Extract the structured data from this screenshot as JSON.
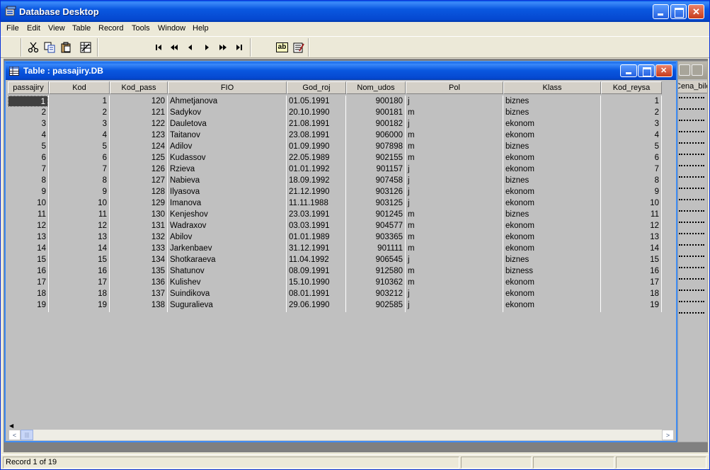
{
  "app": {
    "title": "Database Desktop"
  },
  "menu": [
    "File",
    "Edit",
    "View",
    "Table",
    "Record",
    "Tools",
    "Window",
    "Help"
  ],
  "toolbar": {
    "buttons": [
      "cut-icon",
      "copy-icon",
      "paste-icon",
      "restructure-icon",
      "first-record-icon",
      "prev-set-icon",
      "prev-record-icon",
      "next-record-icon",
      "next-set-icon",
      "last-record-icon",
      "field-view-icon",
      "edit-data-icon"
    ],
    "field_view_label": "ab"
  },
  "table_window": {
    "title": "Table : passajiry.DB",
    "columns": [
      "passajiry",
      "Kod",
      "Kod_pass",
      "FIO",
      "God_roj",
      "Nom_udos",
      "Pol",
      "Klass",
      "Kod_reysa"
    ],
    "rows": [
      [
        "1",
        "1",
        "120",
        "Ahmetjanova",
        "01.05.1991",
        "900180",
        "j",
        "biznes",
        "1"
      ],
      [
        "2",
        "2",
        "121",
        "Sadykov",
        "20.10.1990",
        "900181",
        "m",
        "biznes",
        "2"
      ],
      [
        "3",
        "3",
        "122",
        "Dauletova",
        "21.08.1991",
        "900182",
        "j",
        "ekonom",
        "3"
      ],
      [
        "4",
        "4",
        "123",
        "Taitanov",
        "23.08.1991",
        "906000",
        "m",
        "ekonom",
        "4"
      ],
      [
        "5",
        "5",
        "124",
        "Adilov",
        "01.09.1990",
        "907898",
        "m",
        "biznes",
        "5"
      ],
      [
        "6",
        "6",
        "125",
        "Kudassov",
        "22.05.1989",
        "902155",
        "m",
        "ekonom",
        "6"
      ],
      [
        "7",
        "7",
        "126",
        "Rzieva",
        "01.01.1992",
        "901157",
        "j",
        "ekonom",
        "7"
      ],
      [
        "8",
        "8",
        "127",
        "Nabieva",
        "18.09.1992",
        "907458",
        "j",
        "biznes",
        "8"
      ],
      [
        "9",
        "9",
        "128",
        "Ilyasova",
        "21.12.1990",
        "903126",
        "j",
        "ekonom",
        "9"
      ],
      [
        "10",
        "10",
        "129",
        "Imanova",
        "11.11.1988",
        "903125",
        "j",
        "ekonom",
        "10"
      ],
      [
        "11",
        "11",
        "130",
        "Kenjeshov",
        "23.03.1991",
        "901245",
        "m",
        "biznes",
        "11"
      ],
      [
        "12",
        "12",
        "131",
        "Wadraxov",
        "03.03.1991",
        "904577",
        "m",
        "ekonom",
        "12"
      ],
      [
        "13",
        "13",
        "132",
        "Abilov",
        "01.01.1989",
        "903365",
        "m",
        "ekonom",
        "13"
      ],
      [
        "14",
        "14",
        "133",
        "Jarkenbaev",
        "31.12.1991",
        "901111",
        "m",
        "ekonom",
        "14"
      ],
      [
        "15",
        "15",
        "134",
        "Shotkaraeva",
        "11.04.1992",
        "906545",
        "j",
        "biznes",
        "15"
      ],
      [
        "16",
        "16",
        "135",
        "Shatunov",
        "08.09.1991",
        "912580",
        "m",
        "bizness",
        "16"
      ],
      [
        "17",
        "17",
        "136",
        "Kulishev",
        "15.10.1990",
        "910362",
        "m",
        "ekonom",
        "17"
      ],
      [
        "18",
        "18",
        "137",
        "Suindikova",
        "08.01.1991",
        "903212",
        "j",
        "ekonom",
        "18"
      ],
      [
        "19",
        "19",
        "138",
        "Suguralieva",
        "29.06.1990",
        "902585",
        "j",
        "ekonom",
        "19"
      ]
    ],
    "selected_row": 1
  },
  "background_window": {
    "column_header": "Cena_bilet"
  },
  "status": {
    "record_text": "Record 1 of 19"
  },
  "colors": {
    "titlebar": "#0548d0",
    "grid_bg": "#c0c0c0",
    "selection": "#404040"
  }
}
